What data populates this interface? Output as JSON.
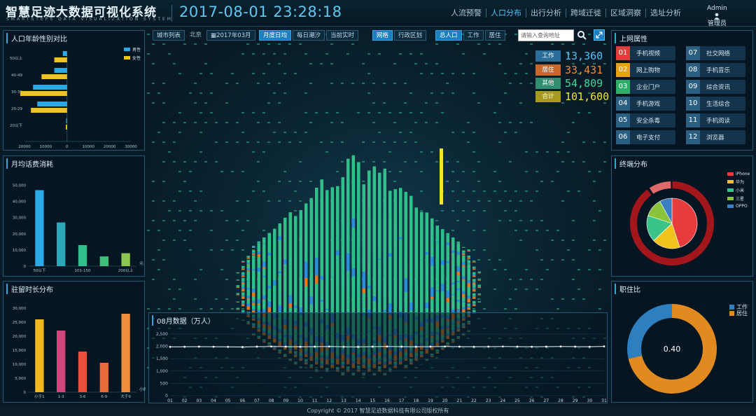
{
  "header": {
    "title": "智慧足迹大数据可视化系统",
    "subtitle": "SMARTSTEPS DATA VISUALIZATION SYSTEM",
    "datetime": "2017-08-01 23:28:18",
    "nav": [
      "人流预警",
      "人口分布",
      "出行分析",
      "跨域迁徙",
      "区域洞察",
      "选址分析"
    ],
    "nav_active": 1,
    "admin_name": "Admin",
    "admin_role": "管理员"
  },
  "controls": {
    "city_list": "城市列表",
    "city": "北京",
    "month": "2017年03月",
    "range": [
      "月度日均",
      "每日潮汐",
      "当前实时"
    ],
    "range_active": 0,
    "view": [
      "网格",
      "行政区划"
    ],
    "view_active": 0,
    "pop": [
      "总人口",
      "工作",
      "居住"
    ],
    "pop_active": 0,
    "search_placeholder": "请输入查询地址"
  },
  "stats": [
    {
      "label": "工作",
      "value": "13,360",
      "color": "#2a6f9a",
      "vcolor": "#4fc3f7"
    },
    {
      "label": "居住",
      "value": "33,431",
      "color": "#c7692a",
      "vcolor": "#f08c3a"
    },
    {
      "label": "其他",
      "value": "54,809",
      "color": "#2f8f6f",
      "vcolor": "#3fd69c"
    },
    {
      "label": "合计",
      "value": "101,600",
      "color": "#a89a1a",
      "vcolor": "#f2e22c"
    }
  ],
  "age_panel": {
    "title": "人口年龄性别对比",
    "legend": [
      "男性",
      "女性"
    ],
    "categories": [
      "50以上",
      "40-49",
      "30-39",
      "20-29",
      "20以下"
    ],
    "x_ticks": [
      "20000",
      "10000",
      "0",
      "10000",
      "20000",
      "30000"
    ]
  },
  "spend_panel": {
    "title": "月均话费消耗",
    "y_ticks": [
      "0",
      "10,000",
      "20,000",
      "30,000",
      "40,000",
      "50,000"
    ],
    "x_ticks": [
      "50以下",
      "101-150",
      "200以上"
    ],
    "unit": "元"
  },
  "stay_panel": {
    "title": "驻留时长分布",
    "y_ticks": [
      "0",
      "5,000",
      "10,000",
      "15,000",
      "20,000",
      "25,000",
      "30,000"
    ],
    "categories": [
      "小于1",
      "1-3",
      "3-6",
      "6-9",
      "大于9"
    ],
    "unit": "小时"
  },
  "august_panel": {
    "title": "08月数据（万人）",
    "y_ticks": [
      "0",
      "500",
      "1,000",
      "1,500",
      "2,000",
      "2,500"
    ],
    "x_ticks": [
      "01",
      "02",
      "03",
      "04",
      "05",
      "06",
      "07",
      "08",
      "09",
      "10",
      "11",
      "12",
      "13",
      "14",
      "15",
      "16",
      "17",
      "18",
      "19",
      "20",
      "21",
      "22",
      "23",
      "24",
      "25",
      "26",
      "27",
      "28",
      "29",
      "30",
      "31"
    ]
  },
  "web_panel": {
    "title": "上网属性",
    "items": [
      {
        "no": "01",
        "label": "手机视频",
        "color": "#e0403c"
      },
      {
        "no": "02",
        "label": "网上购物",
        "color": "#e6a21a"
      },
      {
        "no": "03",
        "label": "企业门户",
        "color": "#2fae6a"
      },
      {
        "no": "04",
        "label": "手机游戏",
        "color": "#2a5f82"
      },
      {
        "no": "05",
        "label": "安全杀毒",
        "color": "#2a5f82"
      },
      {
        "no": "06",
        "label": "电子支付",
        "color": "#2a5f82"
      },
      {
        "no": "07",
        "label": "社交网络",
        "color": "#2a5f82"
      },
      {
        "no": "08",
        "label": "手机音乐",
        "color": "#2a5f82"
      },
      {
        "no": "09",
        "label": "综合资讯",
        "color": "#2a5f82"
      },
      {
        "no": "10",
        "label": "生活综合",
        "color": "#2a5f82"
      },
      {
        "no": "11",
        "label": "手机阅读",
        "color": "#2a5f82"
      },
      {
        "no": "12",
        "label": "浏览器",
        "color": "#2a5f82"
      }
    ]
  },
  "terminal_panel": {
    "title": "终端分布",
    "legend": [
      {
        "label": "iPhone",
        "color": "#e83c3c"
      },
      {
        "label": "华为",
        "color": "#f2c21c"
      },
      {
        "label": "小米",
        "color": "#3bc48a"
      },
      {
        "label": "三星",
        "color": "#8ac43a"
      },
      {
        "label": "OPPO",
        "color": "#3a7fc4"
      }
    ]
  },
  "ratio_panel": {
    "title": "职住比",
    "legend": [
      "工作",
      "居住"
    ],
    "center_value": "0.40"
  },
  "footer": "Copyright © 2017 智慧足迹数据科技有限公司版权所有",
  "chart_data": [
    {
      "type": "bar",
      "orientation": "horizontal",
      "title": "人口年龄性别对比",
      "categories": [
        "50以上",
        "40-49",
        "30-39",
        "20-29",
        "20以下"
      ],
      "series": [
        {
          "name": "男性",
          "values": [
            -2000,
            -6000,
            -16000,
            -14000,
            -400
          ]
        },
        {
          "name": "女性",
          "values": [
            6000,
            12000,
            22000,
            17000,
            600
          ]
        }
      ],
      "xlim": [
        -20000,
        30000
      ]
    },
    {
      "type": "bar",
      "title": "月均话费消耗",
      "categories": [
        "50以下",
        "",
        "101-150",
        "",
        "200以上"
      ],
      "values": [
        47000,
        27000,
        13000,
        6000,
        8000
      ],
      "ylim": [
        0,
        55000
      ],
      "colors": [
        "#2aa8e8",
        "#2aa8b8",
        "#2fbf8a",
        "#3fc07a",
        "#8cc850"
      ]
    },
    {
      "type": "bar",
      "title": "驻留时长分布",
      "categories": [
        "小于1",
        "1-3",
        "3-6",
        "6-9",
        "大于9"
      ],
      "values": [
        26000,
        22000,
        14500,
        10500,
        28000
      ],
      "ylim": [
        0,
        32000
      ],
      "colors": [
        "#f2b91c",
        "#d2457a",
        "#e8503a",
        "#e86a3a",
        "#f08c3a"
      ]
    },
    {
      "type": "line",
      "title": "08月数据（万人）",
      "x": [
        "01",
        "02",
        "03",
        "04",
        "05",
        "06",
        "07",
        "08",
        "09",
        "10",
        "11",
        "12",
        "13",
        "14",
        "15",
        "16",
        "17",
        "18",
        "19",
        "20",
        "21",
        "22",
        "23",
        "24",
        "25",
        "26",
        "27",
        "28",
        "29",
        "30",
        "31"
      ],
      "values": [
        1980,
        1985,
        1990,
        1985,
        1980,
        1975,
        1990,
        1995,
        1990,
        1985,
        1990,
        1995,
        1985,
        1980,
        1990,
        1995,
        1990,
        1985,
        1990,
        1995,
        1990,
        1985,
        1990,
        1995,
        1990,
        1985,
        1990,
        1995,
        1990,
        1985,
        2000
      ],
      "ylim": [
        0,
        2500
      ]
    },
    {
      "type": "pie",
      "title": "终端分布",
      "labels": [
        "iPhone",
        "华为",
        "小米",
        "三星",
        "OPPO"
      ],
      "values": [
        45,
        18,
        17,
        12,
        8
      ]
    },
    {
      "type": "pie",
      "title": "职住比",
      "labels": [
        "工作",
        "居住"
      ],
      "values": [
        28.6,
        71.4
      ]
    }
  ]
}
